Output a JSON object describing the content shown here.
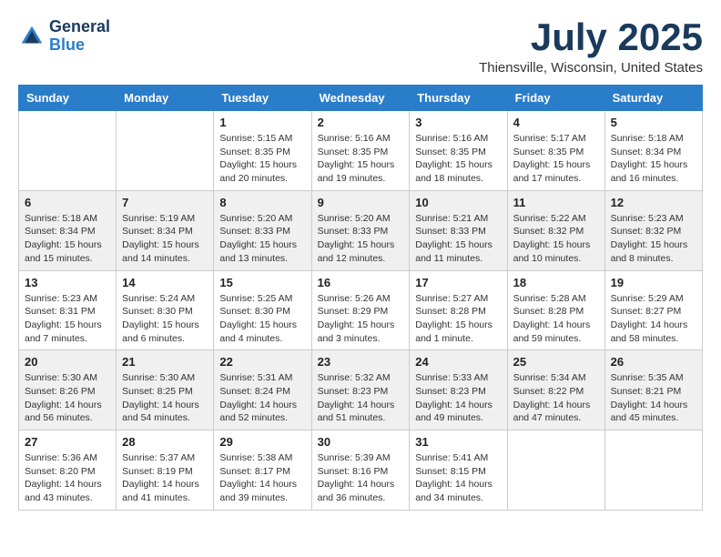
{
  "logo": {
    "line1": "General",
    "line2": "Blue"
  },
  "title": "July 2025",
  "location": "Thiensville, Wisconsin, United States",
  "weekdays": [
    "Sunday",
    "Monday",
    "Tuesday",
    "Wednesday",
    "Thursday",
    "Friday",
    "Saturday"
  ],
  "weeks": [
    [
      {
        "day": "",
        "sunrise": "",
        "sunset": "",
        "daylight": ""
      },
      {
        "day": "",
        "sunrise": "",
        "sunset": "",
        "daylight": ""
      },
      {
        "day": "1",
        "sunrise": "Sunrise: 5:15 AM",
        "sunset": "Sunset: 8:35 PM",
        "daylight": "Daylight: 15 hours and 20 minutes."
      },
      {
        "day": "2",
        "sunrise": "Sunrise: 5:16 AM",
        "sunset": "Sunset: 8:35 PM",
        "daylight": "Daylight: 15 hours and 19 minutes."
      },
      {
        "day": "3",
        "sunrise": "Sunrise: 5:16 AM",
        "sunset": "Sunset: 8:35 PM",
        "daylight": "Daylight: 15 hours and 18 minutes."
      },
      {
        "day": "4",
        "sunrise": "Sunrise: 5:17 AM",
        "sunset": "Sunset: 8:35 PM",
        "daylight": "Daylight: 15 hours and 17 minutes."
      },
      {
        "day": "5",
        "sunrise": "Sunrise: 5:18 AM",
        "sunset": "Sunset: 8:34 PM",
        "daylight": "Daylight: 15 hours and 16 minutes."
      }
    ],
    [
      {
        "day": "6",
        "sunrise": "Sunrise: 5:18 AM",
        "sunset": "Sunset: 8:34 PM",
        "daylight": "Daylight: 15 hours and 15 minutes."
      },
      {
        "day": "7",
        "sunrise": "Sunrise: 5:19 AM",
        "sunset": "Sunset: 8:34 PM",
        "daylight": "Daylight: 15 hours and 14 minutes."
      },
      {
        "day": "8",
        "sunrise": "Sunrise: 5:20 AM",
        "sunset": "Sunset: 8:33 PM",
        "daylight": "Daylight: 15 hours and 13 minutes."
      },
      {
        "day": "9",
        "sunrise": "Sunrise: 5:20 AM",
        "sunset": "Sunset: 8:33 PM",
        "daylight": "Daylight: 15 hours and 12 minutes."
      },
      {
        "day": "10",
        "sunrise": "Sunrise: 5:21 AM",
        "sunset": "Sunset: 8:33 PM",
        "daylight": "Daylight: 15 hours and 11 minutes."
      },
      {
        "day": "11",
        "sunrise": "Sunrise: 5:22 AM",
        "sunset": "Sunset: 8:32 PM",
        "daylight": "Daylight: 15 hours and 10 minutes."
      },
      {
        "day": "12",
        "sunrise": "Sunrise: 5:23 AM",
        "sunset": "Sunset: 8:32 PM",
        "daylight": "Daylight: 15 hours and 8 minutes."
      }
    ],
    [
      {
        "day": "13",
        "sunrise": "Sunrise: 5:23 AM",
        "sunset": "Sunset: 8:31 PM",
        "daylight": "Daylight: 15 hours and 7 minutes."
      },
      {
        "day": "14",
        "sunrise": "Sunrise: 5:24 AM",
        "sunset": "Sunset: 8:30 PM",
        "daylight": "Daylight: 15 hours and 6 minutes."
      },
      {
        "day": "15",
        "sunrise": "Sunrise: 5:25 AM",
        "sunset": "Sunset: 8:30 PM",
        "daylight": "Daylight: 15 hours and 4 minutes."
      },
      {
        "day": "16",
        "sunrise": "Sunrise: 5:26 AM",
        "sunset": "Sunset: 8:29 PM",
        "daylight": "Daylight: 15 hours and 3 minutes."
      },
      {
        "day": "17",
        "sunrise": "Sunrise: 5:27 AM",
        "sunset": "Sunset: 8:28 PM",
        "daylight": "Daylight: 15 hours and 1 minute."
      },
      {
        "day": "18",
        "sunrise": "Sunrise: 5:28 AM",
        "sunset": "Sunset: 8:28 PM",
        "daylight": "Daylight: 14 hours and 59 minutes."
      },
      {
        "day": "19",
        "sunrise": "Sunrise: 5:29 AM",
        "sunset": "Sunset: 8:27 PM",
        "daylight": "Daylight: 14 hours and 58 minutes."
      }
    ],
    [
      {
        "day": "20",
        "sunrise": "Sunrise: 5:30 AM",
        "sunset": "Sunset: 8:26 PM",
        "daylight": "Daylight: 14 hours and 56 minutes."
      },
      {
        "day": "21",
        "sunrise": "Sunrise: 5:30 AM",
        "sunset": "Sunset: 8:25 PM",
        "daylight": "Daylight: 14 hours and 54 minutes."
      },
      {
        "day": "22",
        "sunrise": "Sunrise: 5:31 AM",
        "sunset": "Sunset: 8:24 PM",
        "daylight": "Daylight: 14 hours and 52 minutes."
      },
      {
        "day": "23",
        "sunrise": "Sunrise: 5:32 AM",
        "sunset": "Sunset: 8:23 PM",
        "daylight": "Daylight: 14 hours and 51 minutes."
      },
      {
        "day": "24",
        "sunrise": "Sunrise: 5:33 AM",
        "sunset": "Sunset: 8:23 PM",
        "daylight": "Daylight: 14 hours and 49 minutes."
      },
      {
        "day": "25",
        "sunrise": "Sunrise: 5:34 AM",
        "sunset": "Sunset: 8:22 PM",
        "daylight": "Daylight: 14 hours and 47 minutes."
      },
      {
        "day": "26",
        "sunrise": "Sunrise: 5:35 AM",
        "sunset": "Sunset: 8:21 PM",
        "daylight": "Daylight: 14 hours and 45 minutes."
      }
    ],
    [
      {
        "day": "27",
        "sunrise": "Sunrise: 5:36 AM",
        "sunset": "Sunset: 8:20 PM",
        "daylight": "Daylight: 14 hours and 43 minutes."
      },
      {
        "day": "28",
        "sunrise": "Sunrise: 5:37 AM",
        "sunset": "Sunset: 8:19 PM",
        "daylight": "Daylight: 14 hours and 41 minutes."
      },
      {
        "day": "29",
        "sunrise": "Sunrise: 5:38 AM",
        "sunset": "Sunset: 8:17 PM",
        "daylight": "Daylight: 14 hours and 39 minutes."
      },
      {
        "day": "30",
        "sunrise": "Sunrise: 5:39 AM",
        "sunset": "Sunset: 8:16 PM",
        "daylight": "Daylight: 14 hours and 36 minutes."
      },
      {
        "day": "31",
        "sunrise": "Sunrise: 5:41 AM",
        "sunset": "Sunset: 8:15 PM",
        "daylight": "Daylight: 14 hours and 34 minutes."
      },
      {
        "day": "",
        "sunrise": "",
        "sunset": "",
        "daylight": ""
      },
      {
        "day": "",
        "sunrise": "",
        "sunset": "",
        "daylight": ""
      }
    ]
  ]
}
